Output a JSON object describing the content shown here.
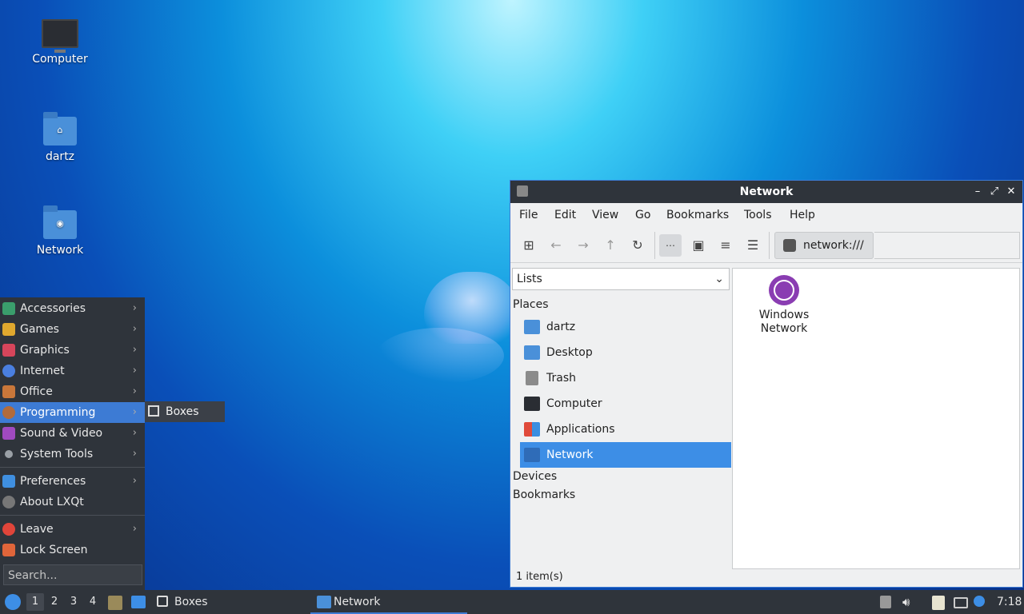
{
  "desktop": {
    "icons": [
      {
        "label": "Computer",
        "icon": "computer-icon"
      },
      {
        "label": "dartz",
        "icon": "home-folder-icon"
      },
      {
        "label": "Network",
        "icon": "network-folder-icon"
      }
    ]
  },
  "start_menu": {
    "items": [
      {
        "label": "Accessories",
        "icon": "accessories-icon",
        "color": "#3a9e6c",
        "submenu": true
      },
      {
        "label": "Games",
        "icon": "games-icon",
        "color": "#e0a82e",
        "submenu": true
      },
      {
        "label": "Graphics",
        "icon": "graphics-icon",
        "color": "#d6455b",
        "submenu": true
      },
      {
        "label": "Internet",
        "icon": "internet-icon",
        "color": "#4a7fe0",
        "submenu": true
      },
      {
        "label": "Office",
        "icon": "office-icon",
        "color": "#c9773a",
        "submenu": true
      },
      {
        "label": "Programming",
        "icon": "programming-icon",
        "color": "#b26b3c",
        "submenu": true,
        "selected": true
      },
      {
        "label": "Sound & Video",
        "icon": "sound-video-icon",
        "color": "#a04ac0",
        "submenu": true
      },
      {
        "label": "System Tools",
        "icon": "system-tools-icon",
        "color": "#9aa0a6",
        "submenu": true
      },
      {
        "label": "Preferences",
        "icon": "preferences-icon",
        "color": "#3f8fe0",
        "submenu": true
      },
      {
        "label": "About LXQt",
        "icon": "info-icon",
        "color": "#777777",
        "submenu": false
      },
      {
        "label": "Leave",
        "icon": "power-icon",
        "color": "#e0453a",
        "submenu": true
      },
      {
        "label": "Lock Screen",
        "icon": "lock-icon",
        "color": "#e0653a",
        "submenu": false
      }
    ],
    "search_placeholder": "Search...",
    "submenu_item": "Boxes"
  },
  "window": {
    "title": "Network",
    "menubar": [
      "File",
      "Edit",
      "View",
      "Go",
      "Bookmarks",
      "Tools",
      "Help"
    ],
    "address": "network:///",
    "side_combo": "Lists",
    "sections": {
      "places": "Places",
      "devices": "Devices",
      "bookmarks": "Bookmarks"
    },
    "places": [
      {
        "label": "dartz",
        "color": "#4a90d9"
      },
      {
        "label": "Desktop",
        "color": "#4a90d9"
      },
      {
        "label": "Trash",
        "color": "#8b8b8b"
      },
      {
        "label": "Computer",
        "color": "#2a2d33"
      },
      {
        "label": "Applications",
        "color": "#e04a3a"
      },
      {
        "label": "Network",
        "color": "#4a90d9",
        "selected": true
      }
    ],
    "content_items": [
      {
        "label": "Windows Network",
        "icon": "windows-network-icon"
      }
    ],
    "status": "1 item(s)"
  },
  "taskbar": {
    "workspaces": [
      "1",
      "2",
      "3",
      "4"
    ],
    "tasks": [
      "Boxes",
      "Network"
    ],
    "clock": "7:18"
  },
  "colors": {
    "accent": "#3d7bd4",
    "panel": "#2f343b",
    "selection": "#3d8ee6"
  }
}
